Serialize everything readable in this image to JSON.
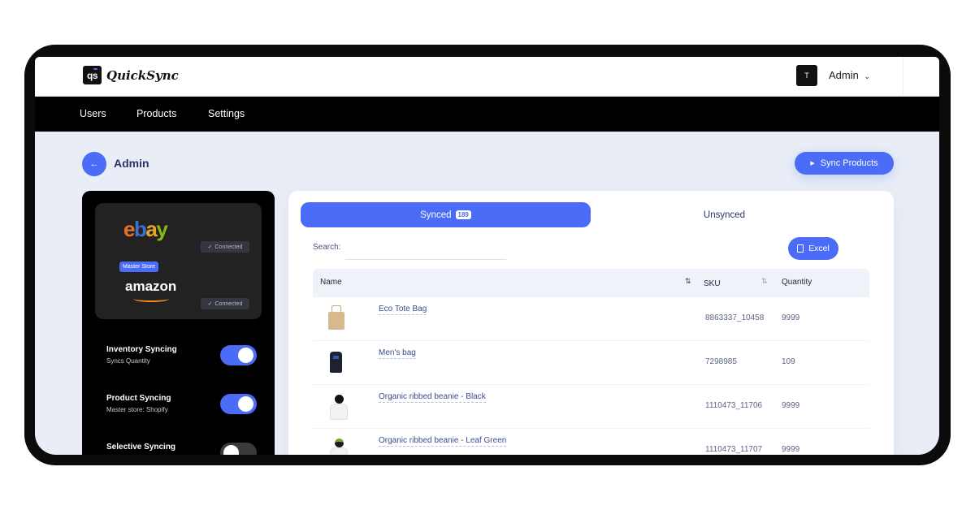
{
  "app": {
    "logo_mark": "qs",
    "logo_text": "QuickSync"
  },
  "user": {
    "avatar_initial": "T",
    "name": "Admin"
  },
  "nav": {
    "items": [
      {
        "label": "Users"
      },
      {
        "label": "Products"
      },
      {
        "label": "Settings"
      }
    ]
  },
  "page": {
    "title": "Admin",
    "sync_button": "Sync Products"
  },
  "stores": {
    "ebay": {
      "name": "ebay",
      "status": "Connected",
      "badge": "Master Store"
    },
    "amazon": {
      "name": "amazon",
      "status": "Connected"
    }
  },
  "settings": [
    {
      "title": "Inventory Syncing",
      "subtitle": "Syncs Quantity",
      "enabled": true
    },
    {
      "title": "Product Syncing",
      "subtitle": "Master store: Shopify",
      "enabled": true
    },
    {
      "title": "Selective Syncing",
      "subtitle": "",
      "enabled": false
    }
  ],
  "tabs": [
    {
      "label": "Synced",
      "count": "189",
      "active": true
    },
    {
      "label": "Unsynced",
      "active": false
    }
  ],
  "search": {
    "label": "Search:",
    "value": ""
  },
  "excel_button": "Excel",
  "table": {
    "columns": [
      "Name",
      "SKU",
      "Quantity"
    ],
    "rows": [
      {
        "name": "Eco Tote Bag",
        "sku": "8863337_10458",
        "quantity": "9999",
        "thumb": "tote-bag"
      },
      {
        "name": "Men's bag",
        "sku": "7298985",
        "quantity": "109",
        "thumb": "backpack"
      },
      {
        "name": "Organic ribbed beanie - Black",
        "sku": "1110473_11706",
        "quantity": "9999",
        "thumb": "beanie-black"
      },
      {
        "name": "Organic ribbed beanie - Leaf Green",
        "sku": "1110473_11707",
        "quantity": "9999",
        "thumb": "beanie-green"
      }
    ]
  },
  "colors": {
    "accent": "#4a6cf7",
    "nav_bg": "#000000",
    "page_bg": "#e9eef6",
    "text_dark": "#2b3467"
  }
}
